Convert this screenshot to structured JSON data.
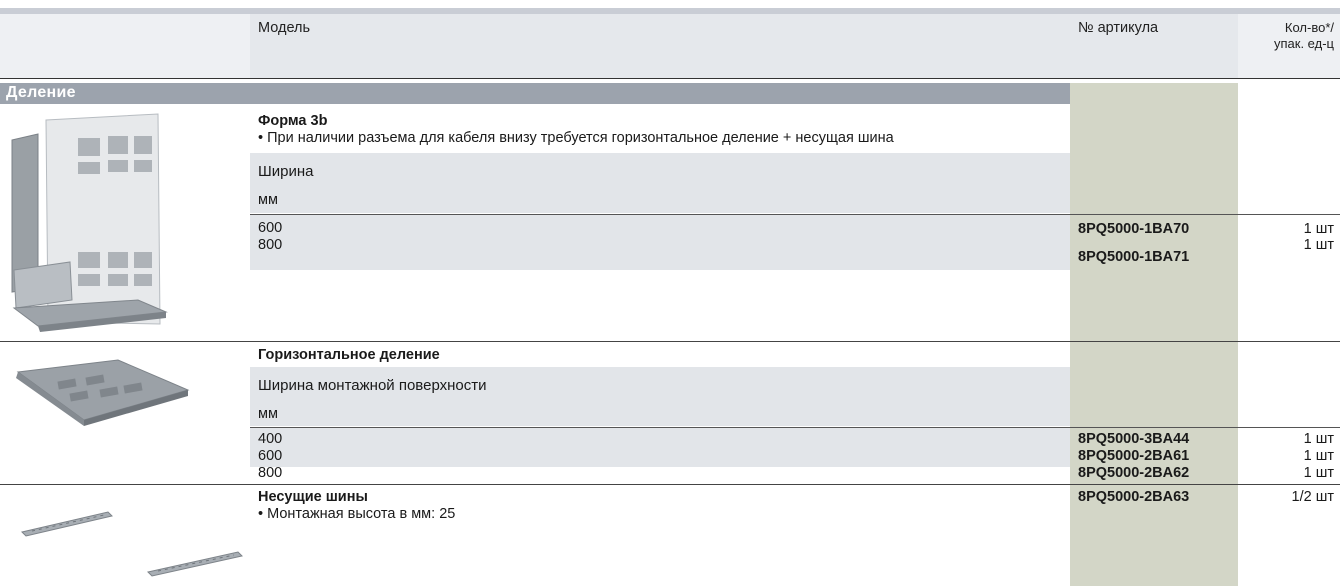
{
  "header": {
    "model_label": "Модель",
    "article_label": "№ артикула",
    "qty_label_line1": "Кол-во*/",
    "qty_label_line2": "упак. ед-ц"
  },
  "section": {
    "title": "Деление"
  },
  "groups": [
    {
      "title": "Форма 3b",
      "note": "• При наличии разъема для кабеля внизу требуется горизонтальное деление + несущая шина",
      "param_label": "Ширина",
      "unit": "мм",
      "rows": [
        {
          "value": "600",
          "article": "8PQ5000-1BA70",
          "qty": "1 шт"
        },
        {
          "value": "800",
          "article": "8PQ5000-1BA71",
          "qty": "1 шт"
        }
      ]
    },
    {
      "title": "Горизонтальное деление",
      "param_label": "Ширина монтажной поверхности",
      "unit": "мм",
      "rows": [
        {
          "value": "400",
          "article": "8PQ5000-3BA44",
          "qty": "1 шт"
        },
        {
          "value": "600",
          "article": "8PQ5000-2BA61",
          "qty": "1 шт"
        },
        {
          "value": "800",
          "article": "8PQ5000-2BA62",
          "qty": "1 шт"
        }
      ]
    },
    {
      "title": "Несущие шины",
      "note": "• Монтажная высота в мм: 25",
      "article": "8PQ5000-2BA63",
      "qty": "1/2 шт"
    }
  ]
}
